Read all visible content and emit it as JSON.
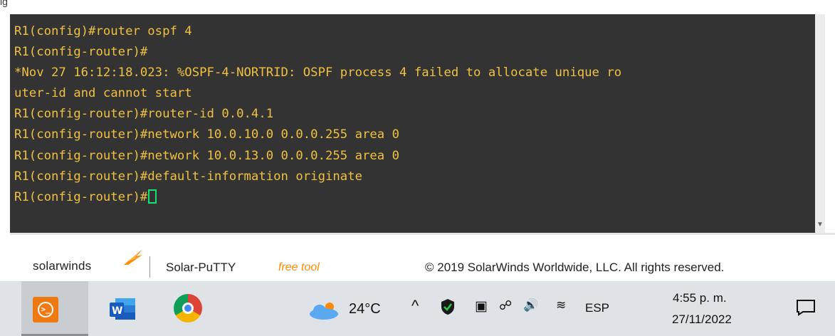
{
  "top_strip": {
    "cut_text": "lg"
  },
  "terminal": {
    "lines": [
      "R1(config)#router ospf 4",
      "R1(config-router)#",
      "*Nov 27 16:12:18.023: %OSPF-4-NORTRID: OSPF process 4 failed to allocate unique ro",
      "uter-id and cannot start",
      "R1(config-router)#router-id 0.0.4.1",
      "R1(config-router)#network 10.0.10.0 0.0.0.255 area 0",
      "R1(config-router)#network 10.0.13.0 0.0.0.255 area 0",
      "R1(config-router)#default-information originate"
    ],
    "prompt": "R1(config-router)#",
    "text_color": "#f0c040",
    "background": "#333333",
    "cursor_color": "#14e36e"
  },
  "footer": {
    "logo": "solarwinds",
    "product": "Solar-PuTTY",
    "edition": "free tool",
    "copyright": "© 2019 SolarWinds Worldwide, LLC. All rights reserved.",
    "accent": "#ff8c00"
  },
  "taskbar": {
    "apps": [
      {
        "name": "Solar-PuTTY",
        "icon": "putty-icon",
        "active": true
      },
      {
        "name": "Word",
        "icon": "word-icon",
        "active": false
      },
      {
        "name": "Chrome",
        "icon": "chrome-icon",
        "active": false
      }
    ],
    "weather": {
      "icon": "cloud-sun-icon",
      "temp": "24°C"
    },
    "tray": {
      "chevron": "^",
      "icons": [
        "shield-icon",
        "meet-now-icon",
        "battery-icon",
        "volume-icon",
        "wifi-icon"
      ],
      "language": "ESP"
    },
    "time": "4:55 p. m.",
    "date": "27/11/2022",
    "notification_icon": "notification-icon"
  }
}
